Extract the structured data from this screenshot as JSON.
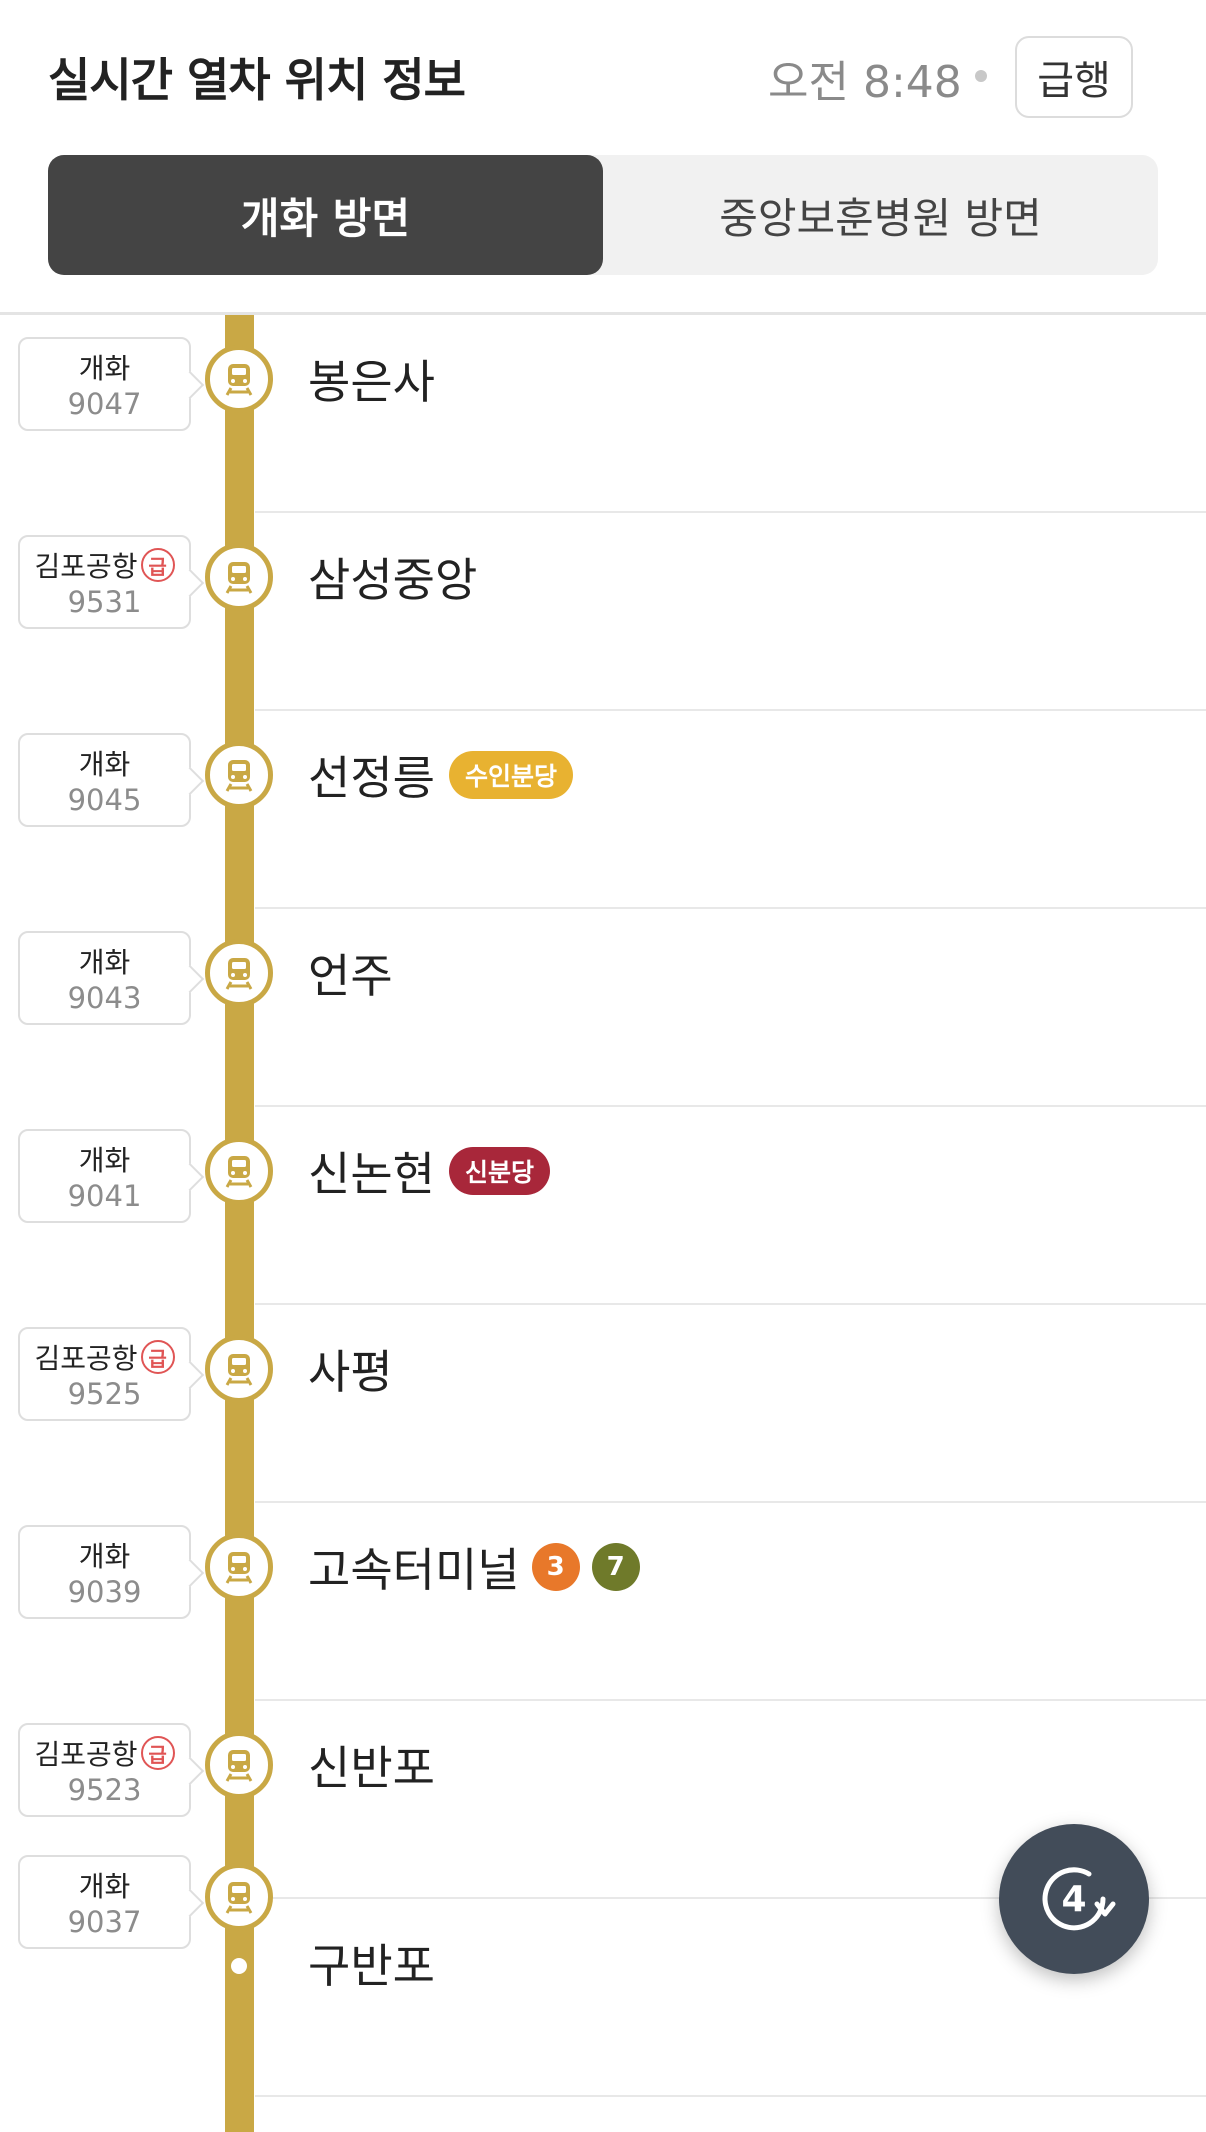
{
  "header": {
    "title": "실시간 열차 위치 정보",
    "time": "오전 8:48",
    "express_button": "급행"
  },
  "tabs": [
    {
      "label": "개화 방면",
      "active": true
    },
    {
      "label": "중앙보훈병원 방면",
      "active": false
    }
  ],
  "colors": {
    "line": "#c9a845",
    "active_tab": "#444444",
    "express_mark": "#e05555",
    "refresh_button": "#424c59"
  },
  "stations": [
    {
      "name": "봉은사"
    },
    {
      "name": "삼성중앙"
    },
    {
      "name": "선정릉",
      "transfer_badge": {
        "label": "수인분당",
        "color": "#e8b231"
      }
    },
    {
      "name": "언주"
    },
    {
      "name": "신논현",
      "transfer_badge": {
        "label": "신분당",
        "color": "#a8273a"
      }
    },
    {
      "name": "사평"
    },
    {
      "name": "고속터미널",
      "transfer_lines": [
        {
          "label": "3",
          "color": "#e8782a"
        },
        {
          "label": "7",
          "color": "#6f7a2a"
        }
      ]
    },
    {
      "name": "신반포"
    },
    {
      "name": "구반포"
    }
  ],
  "trains": [
    {
      "destination": "개화",
      "number": "9047",
      "express": false,
      "express_mark": ""
    },
    {
      "destination": "김포공항",
      "number": "9531",
      "express": true,
      "express_mark": "급"
    },
    {
      "destination": "개화",
      "number": "9045",
      "express": false,
      "express_mark": ""
    },
    {
      "destination": "개화",
      "number": "9043",
      "express": false,
      "express_mark": ""
    },
    {
      "destination": "개화",
      "number": "9041",
      "express": false,
      "express_mark": ""
    },
    {
      "destination": "김포공항",
      "number": "9525",
      "express": true,
      "express_mark": "급"
    },
    {
      "destination": "개화",
      "number": "9039",
      "express": false,
      "express_mark": ""
    },
    {
      "destination": "김포공항",
      "number": "9523",
      "express": true,
      "express_mark": "급"
    },
    {
      "destination": "개화",
      "number": "9037",
      "express": false,
      "express_mark": ""
    }
  ],
  "refresh": {
    "count": "4",
    "icon": "refresh-icon"
  }
}
